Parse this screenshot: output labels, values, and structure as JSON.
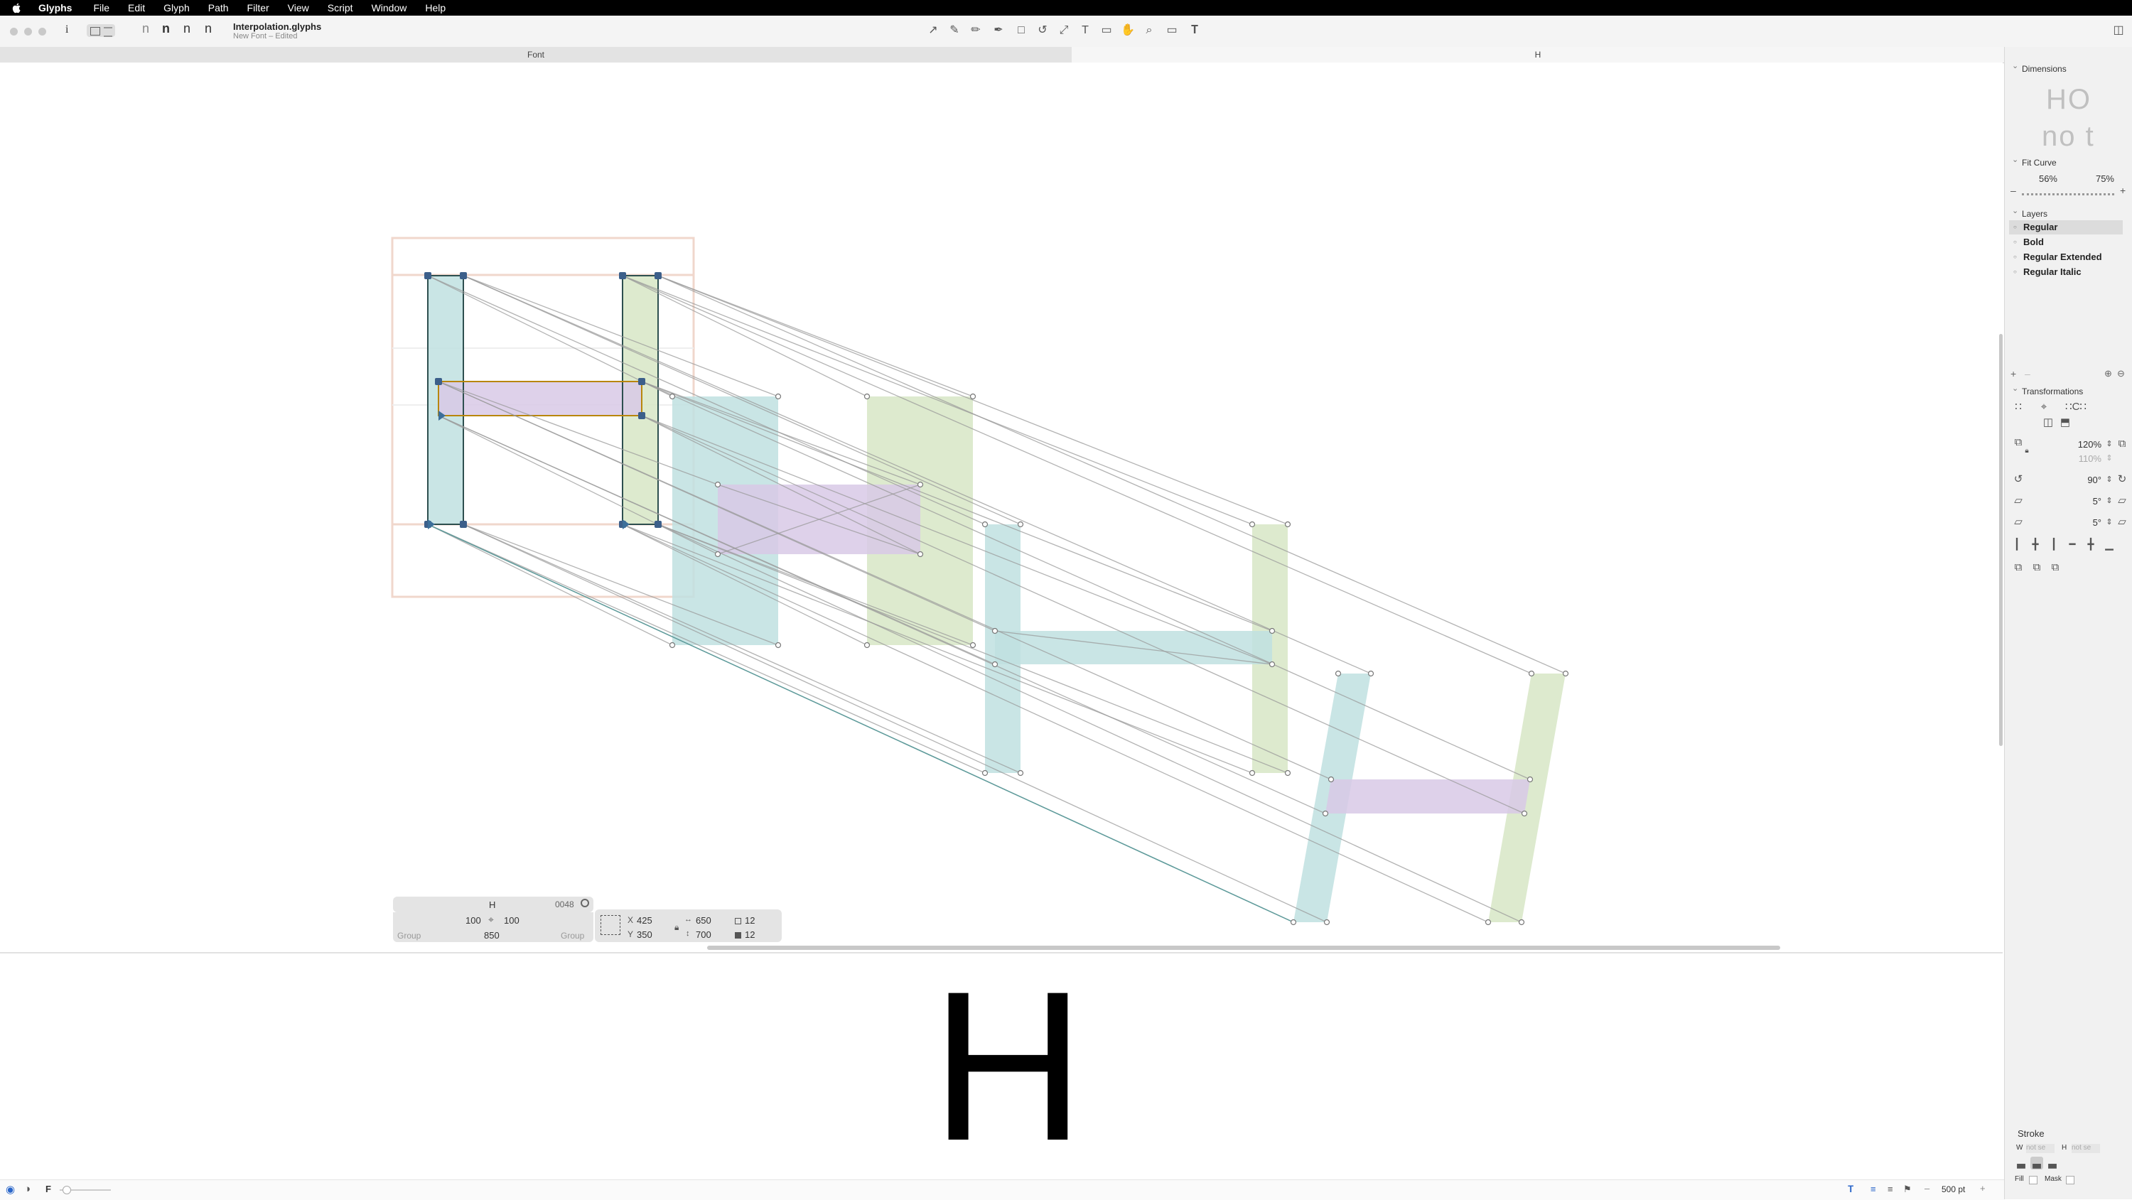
{
  "menubar": {
    "app_name": "Glyphs",
    "items": [
      "File",
      "Edit",
      "Glyph",
      "Path",
      "Filter",
      "View",
      "Script",
      "Window",
      "Help"
    ]
  },
  "toolbar": {
    "info_icon": "i",
    "view_glyphs": [
      "n",
      "n",
      "n",
      "n"
    ],
    "document_title": "Interpolation.glyphs",
    "document_subtitle": "New Font – Edited"
  },
  "tabs": [
    {
      "label": "Font",
      "active": false
    },
    {
      "label": "H",
      "active": true
    }
  ],
  "info_box": {
    "glyph_name": "H",
    "unicode": "0048",
    "lsb": "100",
    "rsb": "100",
    "width": "850",
    "left_group": "Group",
    "right_group": "Group",
    "x": "425",
    "y": "350",
    "x_label": "X",
    "y_label": "Y",
    "w": "650",
    "h": "700",
    "nodes_open": "12",
    "nodes_closed": "12"
  },
  "preview": {
    "glyph": "H"
  },
  "bottombar": {
    "font_label": "F",
    "zoom": "500 pt"
  },
  "panel": {
    "dimensions": {
      "title": "Dimensions",
      "upper_sample": "HO",
      "lower_sample": "no t"
    },
    "fit_curve": {
      "title": "Fit Curve",
      "min_value": "56%",
      "max_value": "75%"
    },
    "layers": {
      "title": "Layers",
      "items": [
        "Regular",
        "Bold",
        "Regular Extended",
        "Regular Italic"
      ],
      "selected_index": 0
    },
    "transformations": {
      "title": "Transformations",
      "scale": "120%",
      "scale_v": "110%",
      "rotate": "90°",
      "slant": "5°",
      "slant_v": "5°"
    },
    "stroke": {
      "title": "Stroke",
      "w_label": "W",
      "w_placeholder": "not se",
      "h_label": "H",
      "h_placeholder": "not se",
      "fill_label": "Fill",
      "mask_label": "Mask"
    }
  },
  "colors": {
    "stem_left": "#bfe0e0",
    "stem_right": "#d7e6c6",
    "crossbar": "#d8c9e6",
    "node": "#3c5f8a",
    "lines": "#9a9a9a"
  }
}
